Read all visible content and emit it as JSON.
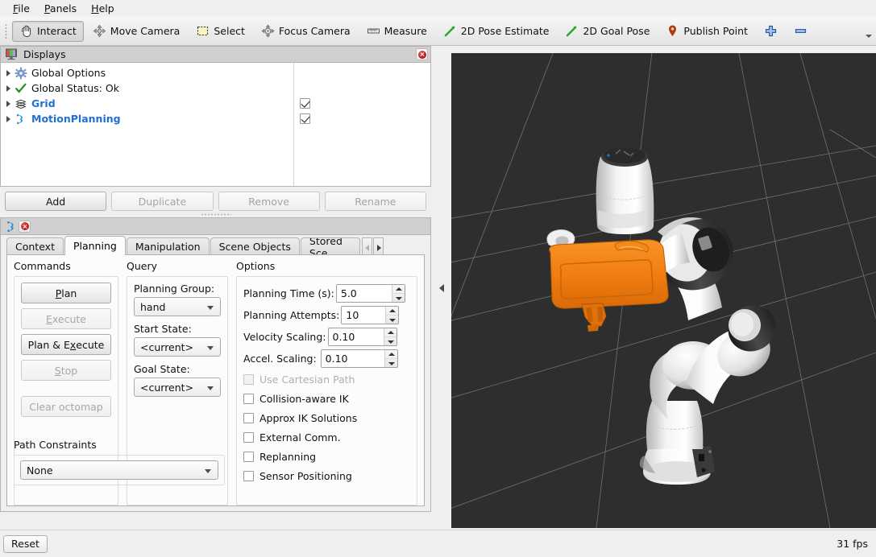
{
  "menu": {
    "items": [
      {
        "pre": "",
        "mn": "F",
        "post": "ile"
      },
      {
        "pre": "",
        "mn": "P",
        "post": "anels"
      },
      {
        "pre": "",
        "mn": "H",
        "post": "elp"
      }
    ]
  },
  "toolbar": {
    "buttons": [
      {
        "label": "Interact",
        "icon": "hand-cursor-icon",
        "checked": true
      },
      {
        "label": "Move Camera",
        "icon": "move-camera-icon",
        "checked": false
      },
      {
        "label": "Select",
        "icon": "select-rect-icon",
        "checked": false
      },
      {
        "label": "Focus Camera",
        "icon": "focus-camera-icon",
        "checked": false
      },
      {
        "label": "Measure",
        "icon": "ruler-icon",
        "checked": false
      },
      {
        "label": "2D Pose Estimate",
        "icon": "pose-arrow-icon",
        "checked": false
      },
      {
        "label": "2D Goal Pose",
        "icon": "pose-arrow-icon",
        "checked": false
      },
      {
        "label": "Publish Point",
        "icon": "map-pin-icon",
        "checked": false
      },
      {
        "label": "",
        "icon": "plus-icon",
        "checked": false
      },
      {
        "label": "",
        "icon": "minus-icon",
        "checked": false
      }
    ]
  },
  "displays": {
    "title": "Displays",
    "tree": [
      {
        "label": "Global Options",
        "icon": "gear-icon",
        "blue": false,
        "checkbox": "none"
      },
      {
        "label": "Global Status: Ok",
        "icon": "check-icon",
        "blue": false,
        "checkbox": "none"
      },
      {
        "label": "Grid",
        "icon": "grid-layers-icon",
        "blue": true,
        "checkbox": "on"
      },
      {
        "label": "MotionPlanning",
        "icon": "moveit-icon",
        "blue": true,
        "checkbox": "on"
      }
    ],
    "buttons": [
      {
        "label": "Add",
        "enabled": true
      },
      {
        "label": "Duplicate",
        "enabled": false
      },
      {
        "label": "Remove",
        "enabled": false
      },
      {
        "label": "Rename",
        "enabled": false
      }
    ]
  },
  "motion_planning": {
    "tabs": [
      {
        "label": "Context",
        "active": false,
        "clipped": false
      },
      {
        "label": "Planning",
        "active": true,
        "clipped": false
      },
      {
        "label": "Manipulation",
        "active": false,
        "clipped": false
      },
      {
        "label": "Scene Objects",
        "active": false,
        "clipped": false
      },
      {
        "label": "Stored Sce",
        "active": false,
        "clipped": true
      }
    ],
    "commands": {
      "title": "Commands",
      "buttons": [
        {
          "pre": "",
          "mn": "P",
          "post": "lan",
          "enabled": true
        },
        {
          "pre": "",
          "mn": "E",
          "post": "xecute",
          "enabled": false
        },
        {
          "pre": "Plan & E",
          "mn": "x",
          "post": "ecute",
          "enabled": true
        },
        {
          "pre": "",
          "mn": "S",
          "post": "top",
          "enabled": false
        },
        {
          "pre": "Clear octomap",
          "mn": "",
          "post": "",
          "enabled": false
        }
      ]
    },
    "query": {
      "title": "Query",
      "fields": [
        {
          "label": "Planning Group:",
          "value": "hand"
        },
        {
          "label": "Start State:",
          "value": "<current>"
        },
        {
          "label": "Goal State:",
          "value": "<current>"
        }
      ]
    },
    "options": {
      "title": "Options",
      "spinners": [
        {
          "label": "Planning Time (s):",
          "value": "5.0"
        },
        {
          "label": "Planning Attempts:",
          "value": "10"
        },
        {
          "label": "Velocity Scaling:",
          "value": "0.10"
        },
        {
          "label": "Accel. Scaling:",
          "value": "0.10"
        }
      ],
      "checkboxes": [
        {
          "label": "Use Cartesian Path",
          "checked": false,
          "enabled": false
        },
        {
          "label": "Collision-aware IK",
          "checked": false,
          "enabled": true
        },
        {
          "label": "Approx IK Solutions",
          "checked": false,
          "enabled": true
        },
        {
          "label": "External Comm.",
          "checked": false,
          "enabled": true
        },
        {
          "label": "Replanning",
          "checked": false,
          "enabled": true
        },
        {
          "label": "Sensor Positioning",
          "checked": false,
          "enabled": true
        }
      ]
    },
    "path_constraints": {
      "title": "Path Constraints",
      "value": "None"
    }
  },
  "statusbar": {
    "reset_label": "Reset",
    "fps": "31 fps"
  },
  "viewport": {
    "background": "#2e2e2e",
    "grid_color": "#8a8a8a",
    "robot_color": "#f2f2f2",
    "robot_dark": "#2f2f2f",
    "gripper_color": "#f07d11"
  }
}
